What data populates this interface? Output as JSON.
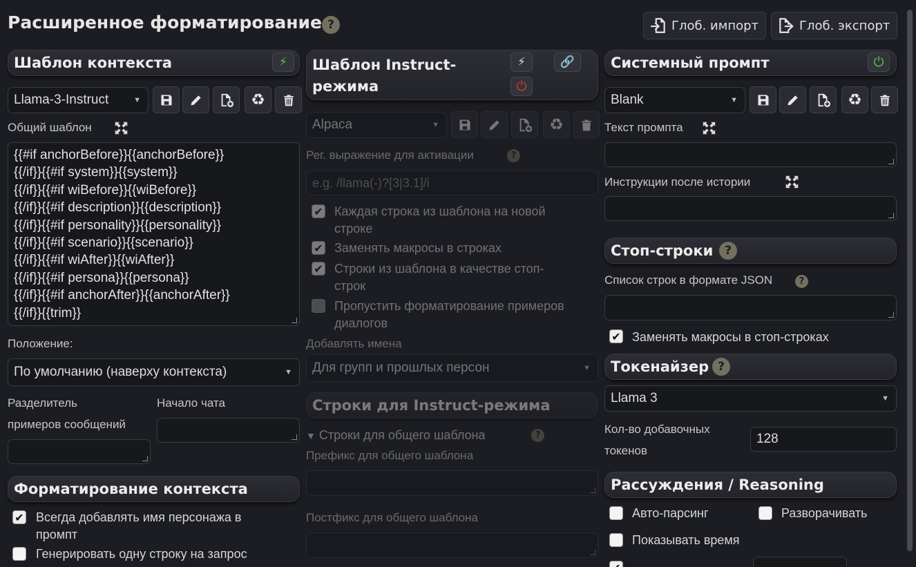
{
  "page": {
    "title": "Расширенное форматирование",
    "help": "?",
    "import_label": "Глоб. импорт",
    "export_label": "Глоб. экспорт"
  },
  "context": {
    "header": "Шаблон контекста",
    "preset": "Llama-3-Instruct",
    "story_label": "Общий шаблон",
    "story_lines": [
      "{{#if anchorBefore}}{{anchorBefore}}",
      "{{/if}}{{#if system}}{{system}}",
      "{{/if}}{{#if wiBefore}}{{wiBefore}}",
      "{{/if}}{{#if description}}{{description}}",
      "{{/if}}{{#if personality}}{{personality}}",
      "{{/if}}{{#if scenario}}{{scenario}}",
      "{{/if}}{{#if wiAfter}}{{wiAfter}}",
      "{{/if}}{{#if persona}}{{persona}}",
      "{{/if}}{{#if anchorAfter}}{{anchorAfter}}",
      "{{/if}}{{trim}}"
    ],
    "position_label": "Положение:",
    "position_value": "По умолчанию (наверху контекста)",
    "separator_label_1": "Разделитель",
    "separator_label_2": "примеров сообщений",
    "chat_start_label": "Начало чата",
    "formatting_header": "Форматирование контекста",
    "always_add_name": "Всегда добавлять имя персонажа в",
    "always_add_name_2": "промпт",
    "single_line": "Генерировать одну строку на запрос"
  },
  "instruct": {
    "header_1": "Шаблон Instruct-",
    "header_2": "режима",
    "preset": "Alpaca",
    "activation_label": "Рег. выражение для активации",
    "activation_placeholder": "e.g. /llama(-)?[3|3.1]/i",
    "wrap_1": "Каждая строка из шаблона на новой",
    "wrap_2": "строке",
    "macro": "Заменять макросы в строках",
    "stop_1": "Строки из шаблона в качестве стоп-",
    "stop_2": "строк",
    "skip_1": "Пропустить форматирование примеров",
    "skip_2": "диалогов",
    "names_label": "Добавлять имена",
    "names_value": "Для групп и прошлых персон",
    "sequences_header": "Строки для Instruct-режима",
    "story_seq_label": "Строки для общего шаблона",
    "prefix_label": "Префикс для общего шаблона",
    "suffix_label": "Постфикс для общего шаблона"
  },
  "system": {
    "header": "Системный промпт",
    "preset": "Blank",
    "prompt_label": "Текст промпта",
    "post_history_label": "Инструкции после истории",
    "stop_header": "Стоп-строки",
    "stop_list_label": "Список строк в формате JSON",
    "stop_macro": "Заменять макросы в стоп-строках",
    "tokenizer_header": "Токенайзер",
    "tokenizer_value": "Llama 3",
    "padding_label_1": "Кол-во добавочных",
    "padding_label_2": "токенов",
    "padding_value": "128",
    "reasoning_header": "Рассуждения / Reasoning",
    "auto_parse": "Авто-парсинг",
    "expand": "Разворачивать",
    "show_time": "Показывать время"
  },
  "colors": {
    "background": "#1c1d22",
    "green_bolt": "#58c24d",
    "red_power": "#d23b2e"
  }
}
